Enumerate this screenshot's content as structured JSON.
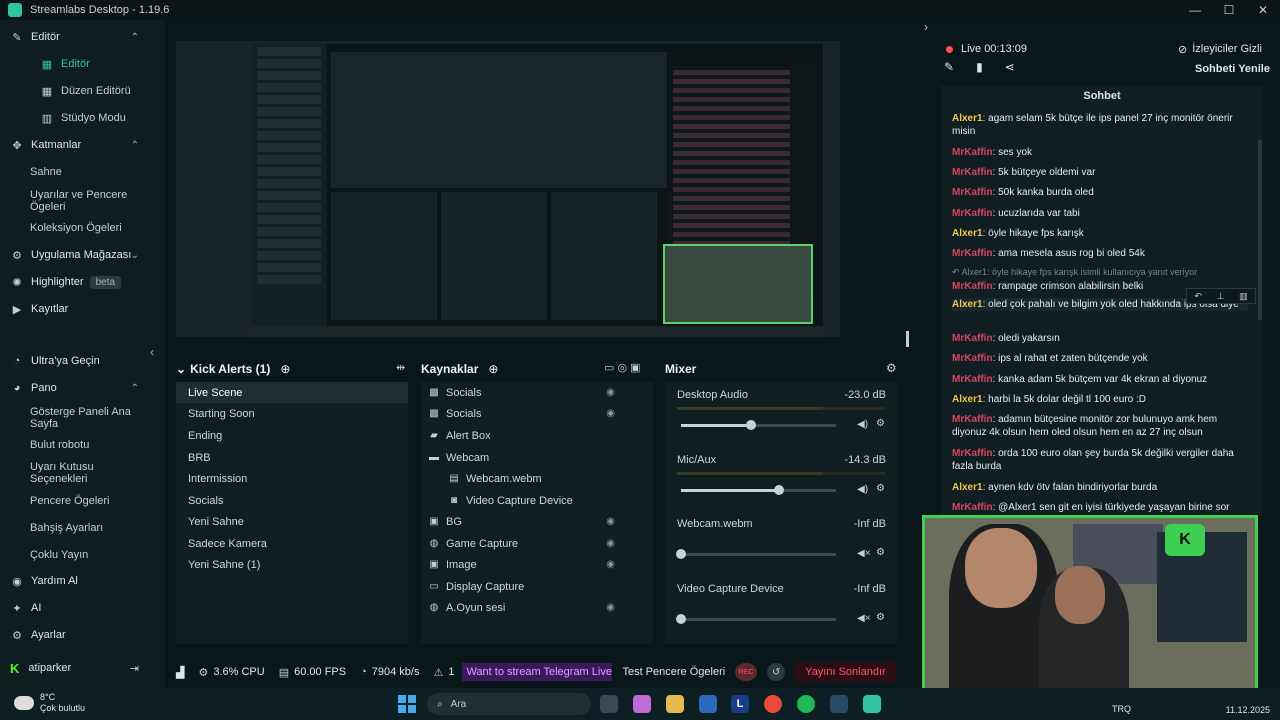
{
  "window": {
    "title": "Streamlabs Desktop - 1.19.6"
  },
  "sidebar": {
    "items": [
      {
        "label": "Editör",
        "icon": "editor-icon",
        "type": "section"
      },
      {
        "label": "Editör",
        "type": "sub",
        "active": true,
        "icon": "editor-grid-icon"
      },
      {
        "label": "Düzen Editörü",
        "type": "sub",
        "icon": "layout-editor-icon"
      },
      {
        "label": "Stüdyo Modu",
        "type": "sub",
        "icon": "studio-mode-icon"
      },
      {
        "label": "Katmanlar",
        "icon": "layers-icon",
        "type": "section"
      },
      {
        "label": "Sahne",
        "type": "sub"
      },
      {
        "label": "Uyarılar ve Pencere Ögeleri",
        "type": "sub"
      },
      {
        "label": "Koleksiyon Ögeleri",
        "type": "sub"
      },
      {
        "label": "Uygulama Mağazası",
        "icon": "app-store-icon",
        "type": "section"
      },
      {
        "label": "Highlighter",
        "icon": "highlighter-icon",
        "type": "section",
        "badge": "beta"
      },
      {
        "label": "Kayıtlar",
        "icon": "recordings-icon",
        "type": "section"
      },
      {
        "label": "Ultra'ya Geçin",
        "icon": "ultra-icon",
        "type": "section"
      },
      {
        "label": "Pano",
        "icon": "dashboard-icon",
        "type": "section"
      },
      {
        "label": "Gösterge Paneli Ana Sayfa",
        "type": "sub"
      },
      {
        "label": "Bulut robotu",
        "type": "sub"
      },
      {
        "label": "Uyarı Kutusu Seçenekleri",
        "type": "sub"
      },
      {
        "label": "Pencere Ögeleri",
        "type": "sub"
      },
      {
        "label": "Bahşiş Ayarları",
        "type": "sub"
      },
      {
        "label": "Çoklu Yayın",
        "type": "sub"
      },
      {
        "label": "Yardım Al",
        "icon": "help-icon",
        "type": "section"
      },
      {
        "label": "AI",
        "icon": "ai-icon",
        "type": "section"
      },
      {
        "label": "Ayarlar",
        "icon": "settings-icon",
        "type": "section"
      }
    ],
    "user": {
      "name": "atiparker",
      "icon": "kick-icon"
    }
  },
  "scenes": {
    "title": "Kick Alerts (1)",
    "items": [
      "Live Scene",
      "Starting Soon",
      "Ending",
      "BRB",
      "Intermission",
      "Socials",
      "Yeni Sahne",
      "Sadece Kamera",
      "Yeni Sahne (1)"
    ],
    "selected": 0
  },
  "sources": {
    "title": "Kaynaklar",
    "items": [
      {
        "label": "Socials",
        "icon": "scene-icon",
        "indent": 0
      },
      {
        "label": "Socials",
        "icon": "scene-icon",
        "indent": 0
      },
      {
        "label": "Alert Box",
        "icon": "alertbox-icon",
        "indent": 0
      },
      {
        "label": "Webcam",
        "icon": "folder-icon",
        "indent": 0
      },
      {
        "label": "Webcam.webm",
        "icon": "media-icon",
        "indent": 1
      },
      {
        "label": "Video Capture Device",
        "icon": "camera-icon",
        "indent": 1
      },
      {
        "label": "BG",
        "icon": "image-icon",
        "indent": 0
      },
      {
        "label": "Game Capture",
        "icon": "gamepad-icon",
        "indent": 0
      },
      {
        "label": "Image",
        "icon": "image-icon",
        "indent": 0
      },
      {
        "label": "Display Capture",
        "icon": "monitor-icon",
        "indent": 0
      },
      {
        "label": "A.Oyun sesi",
        "icon": "gamepad-icon",
        "indent": 0
      }
    ]
  },
  "mixer": {
    "title": "Mixer",
    "channels": [
      {
        "name": "Desktop Audio",
        "db": "-23.0 dB",
        "level": 0.45
      },
      {
        "name": "Mic/Aux",
        "db": "-14.3 dB",
        "level": 0.63
      },
      {
        "name": "Webcam.webm",
        "db": "-Inf dB",
        "level": 0.0
      },
      {
        "name": "Video Capture Device",
        "db": "-Inf dB",
        "level": 0.0
      }
    ]
  },
  "status": {
    "cpu": "3.6% CPU",
    "fps": "60.00 FPS",
    "kbps": "7904 kb/s",
    "alerts": "1",
    "ticker": "Want to stream Telegram Live St",
    "test": "Test Pencere Ögeleri",
    "rec": "REC",
    "end_stream": "Yayını Sonlandır"
  },
  "live": {
    "label": "Live",
    "time": "00:13:09",
    "viewers_hidden": "İzleyiciler Gizli",
    "refresh": "Sohbeti Yenile"
  },
  "chat": {
    "title": "Sohbet",
    "messages": [
      {
        "user": "Alxer1",
        "text": "agam selam 5k bütçe ile ips panel 27 inç monitör önerir misin"
      },
      {
        "user": "MrKaffin",
        "text": "ses yok"
      },
      {
        "user": "MrKaffin",
        "text": "5k bütçeye oldemi var"
      },
      {
        "user": "MrKaffin",
        "text": "50k kanka burda oled"
      },
      {
        "user": "MrKaffin",
        "text": "ucuzlarıda var tabi"
      },
      {
        "user": "Alxer1",
        "text": "öyle hikaye fps karışk"
      },
      {
        "user": "MrKaffin",
        "text": "ama mesela asus rog bi oled 54k"
      },
      {
        "reply": "Alxer1: öyle hikaye fps karışk isimli kullanıcıya yanıt veriyor"
      },
      {
        "user": "MrKaffin",
        "text": "rampage crimson alabilirsin belki"
      },
      {
        "user": "Alxer1",
        "text": "oled çok pahalı ve bilgim yok oled hakkında ips olsa diye"
      },
      {
        "user": "MrKaffin",
        "text": "oledi yakarsın"
      },
      {
        "user": "MrKaffin",
        "text": "ips al rahat et zaten bütçende yok"
      },
      {
        "user": "MrKaffin",
        "text": "kanka adam 5k bütçem var 4k ekran al diyonuz"
      },
      {
        "user": "Alxer1",
        "text": "harbi la 5k dolar değil tl 100 euro :D"
      },
      {
        "user": "MrKaffin",
        "text": "adamın bütçesine monitör zor bulunuyo amk hem diyonuz 4k olsun hem oled olsun hem en az 27 inç olsun"
      },
      {
        "user": "MrKaffin",
        "text": "orda 100 euro olan şey burda 5k değilki vergiler daha fazla burda"
      },
      {
        "user": "Alxer1",
        "text": "aynen kdv ötv falan bindiriyorlar burda"
      },
      {
        "user": "MrKaffin",
        "text": "@Alxer1 sen git en iyisi türkiyede yaşayan birine sor"
      }
    ]
  },
  "taskbar": {
    "weather_temp": "8°C",
    "weather_desc": "Çok bulutlu",
    "search": "Ara",
    "lang": "TRQ",
    "date": "11.12.2025"
  },
  "colors": {
    "accent": "#31c3a2",
    "live": "#ff4a5a",
    "user_alxer": "#f4c64f",
    "user_mrkaffin": "#d64562",
    "webcam_border": "#3fcf52"
  }
}
